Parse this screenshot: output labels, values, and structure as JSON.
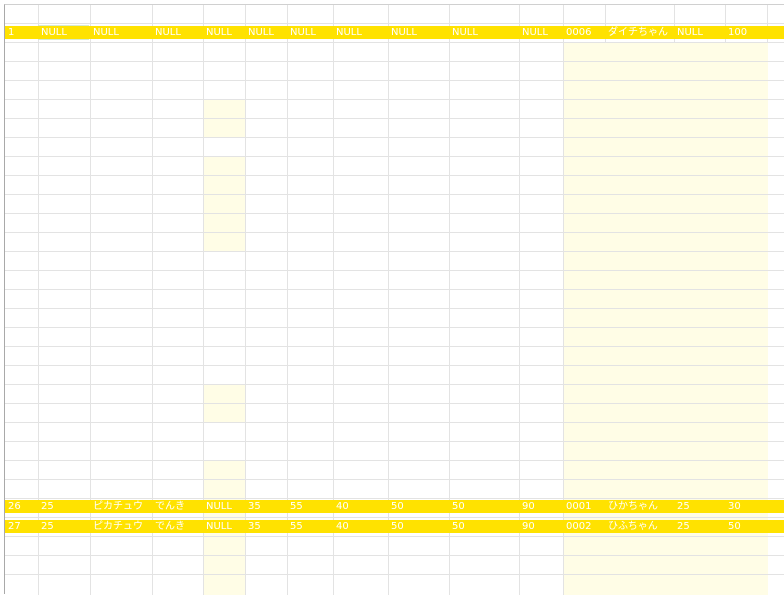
{
  "grid": {
    "rows": [
      {
        "row_id": "row-1",
        "cells": [
          "1",
          "NULL",
          "NULL",
          "NULL",
          "NULL",
          "NULL",
          "NULL",
          "NULL",
          "NULL",
          "NULL",
          "NULL",
          "0006",
          "ダイチちゃん",
          "NULL",
          "100"
        ]
      },
      {
        "row_id": "row-26",
        "cells": [
          "26",
          "25",
          "ピカチュウ",
          "でんき",
          "NULL",
          "35",
          "55",
          "40",
          "50",
          "50",
          "90",
          "0001",
          "ひかちゃん",
          "25",
          "30"
        ]
      },
      {
        "row_id": "row-27",
        "cells": [
          "27",
          "25",
          "ピカチュウ",
          "でんき",
          "NULL",
          "35",
          "55",
          "40",
          "50",
          "50",
          "90",
          "0002",
          "ひふちゃん",
          "25",
          "50"
        ]
      }
    ]
  },
  "colors": {
    "highlight": "#ffe200",
    "pale_fill": "#fffde6",
    "gridline": "#e3e3e3",
    "selected_cell": "#cfe6c6",
    "text": "#ffffff"
  }
}
